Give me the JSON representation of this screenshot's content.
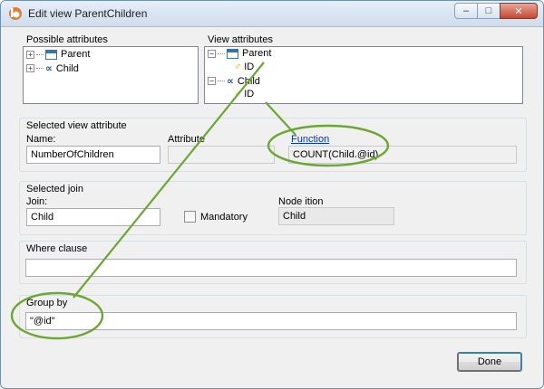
{
  "window": {
    "title": "Edit view ParentChildren"
  },
  "possible_attributes": {
    "label": "Possible attributes",
    "items": [
      {
        "label": "Parent",
        "icon": "table-icon"
      },
      {
        "label": "Child",
        "icon": "relation-icon"
      }
    ]
  },
  "view_attributes": {
    "label": "View attributes",
    "items": [
      {
        "label": "Parent",
        "icon": "table-icon"
      },
      {
        "label": "ID",
        "icon": "key-icon"
      },
      {
        "label": "Child",
        "icon": "relation-icon"
      },
      {
        "label": "ID",
        "icon": "key-icon"
      }
    ]
  },
  "selected_view_attribute": {
    "label": "Selected view attribute",
    "name_label": "Name:",
    "name_value": "NumberOfChildren",
    "attribute_label": "Attribute",
    "attribute_value": "",
    "function_link": "Function",
    "function_value": "COUNT(Child.@id)"
  },
  "selected_join": {
    "label": "Selected join",
    "join_label": "Join:",
    "join_value": "Child",
    "mandatory_label": "Mandatory",
    "mandatory_checked": false,
    "node_label": "Node ition",
    "node_value": "Child"
  },
  "where_clause": {
    "label": "Where clause",
    "value": ""
  },
  "group_by": {
    "label": "Group by",
    "value": "\"@id\""
  },
  "buttons": {
    "done": "Done"
  },
  "colors": {
    "annotation": "#6aa832",
    "link": "#0033cc"
  }
}
